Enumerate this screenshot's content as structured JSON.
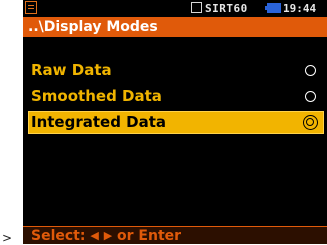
{
  "status_bar": {
    "indicators": "SIRT60",
    "time": "19:44",
    "battery_color": "#2a63d9"
  },
  "title_bar": {
    "title": "..\\Display Modes",
    "color": "#e05a0a"
  },
  "options": [
    {
      "label": "Raw Data",
      "selected": false
    },
    {
      "label": "Smoothed Data",
      "selected": false
    },
    {
      "label": "Integrated Data",
      "selected": true
    }
  ],
  "footer": {
    "hint_prefix": "Select:",
    "arrow_left": "◀",
    "arrow_right": "▶",
    "hint_suffix": "or Enter"
  },
  "colors": {
    "highlight": "#f2b400",
    "text_option": "#f0b400",
    "background": "#000000"
  },
  "icons": {
    "file": "document-icon",
    "radio": "radio-button-icon"
  }
}
